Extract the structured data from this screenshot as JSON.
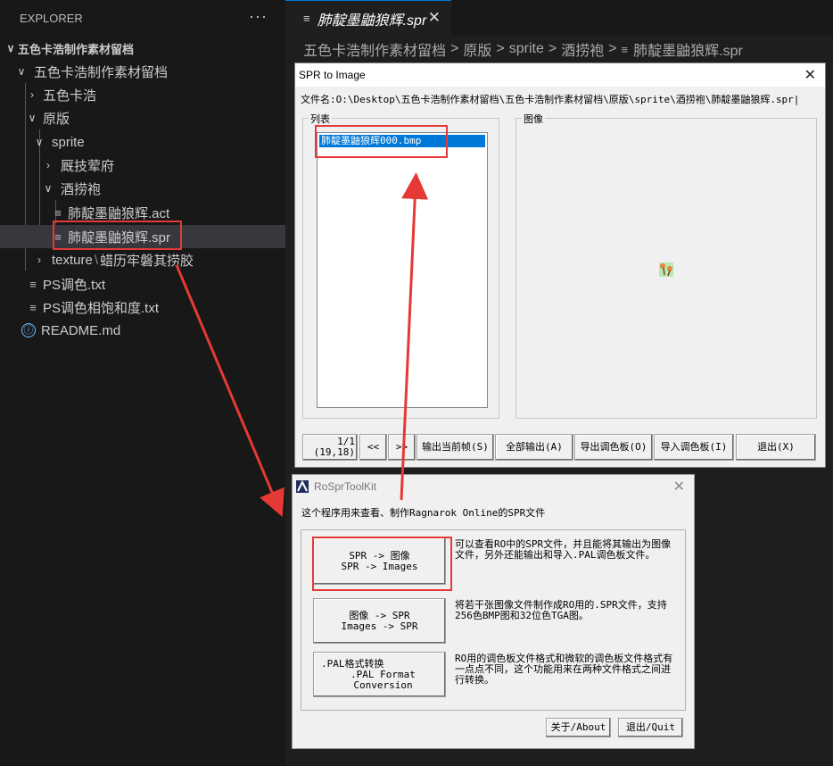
{
  "explorer": {
    "title": "EXPLORER",
    "more_icon": "···",
    "items": [
      {
        "label": "五色卡浩制作素材留档",
        "twisty": "∨"
      },
      {
        "label": "五色卡浩制作素材留档",
        "twisty": "∨"
      },
      {
        "label": "五色卡浩",
        "twisty": "›"
      },
      {
        "label": "原版",
        "twisty": "∨"
      },
      {
        "label": "sprite",
        "twisty": "∨"
      },
      {
        "label": "厩技荤府",
        "twisty": "›"
      },
      {
        "label": "酒捞袍",
        "twisty": "∨"
      },
      {
        "label": "肺靛墨鼬狼辉.act",
        "icon": "≡"
      },
      {
        "label": "肺靛墨鼬狼辉.spr",
        "icon": "≡"
      },
      {
        "label_a": "texture",
        "label_sep": "\\",
        "label_b": "蜡历牢磐其捞胶",
        "twisty": "›"
      },
      {
        "label": "PS调色.txt",
        "icon": "≡"
      },
      {
        "label": "PS调色相饱和度.txt",
        "icon": "≡"
      },
      {
        "label": "README.md",
        "icon": "ⓘ"
      }
    ]
  },
  "editor": {
    "tab": {
      "icon": "≡",
      "label": "肺靛墨鼬狼辉.spr",
      "close": "✕"
    },
    "breadcrumb": [
      "五色卡浩制作素材留档",
      "原版",
      "sprite",
      "酒捞袍",
      "肺靛墨鼬狼辉.spr"
    ],
    "breadcrumb_sep": ">",
    "breadcrumb_file_icon": "≡"
  },
  "spr_dialog": {
    "title": "SPR to Image",
    "close": "✕",
    "filename": "文件名:O:\\Desktop\\五色卡浩制作素材留档\\五色卡浩制作素材留档\\原版\\sprite\\酒捞袍\\肺靛墨鼬狼辉.spr|",
    "list_label": "列表",
    "list_items": [
      "肺靛墨鼬狼辉000.bmp"
    ],
    "image_label": "图像",
    "frame_counter": "1/1",
    "frame_size": "(19,18)",
    "buttons": [
      "<<",
      ">>",
      "输出当前帧(S)",
      "全部输出(A)",
      "导出调色板(O)",
      "导入调色板(I)",
      "退出(X)"
    ]
  },
  "toolkit": {
    "title": "RoSprToolKit",
    "close": "✕",
    "intro": "这个程序用来查看、制作Ragnarok Online的SPR文件",
    "rows": [
      {
        "btn_line1": "SPR -> 图像",
        "btn_line2": "SPR -> Images",
        "desc": "可以查看RO中的SPR文件，并且能将其输出为图像文件，另外还能输出和导入.PAL调色板文件。"
      },
      {
        "btn_line1": "图像 -> SPR",
        "btn_line2": "Images -> SPR",
        "desc": "将若干张图像文件制作成RO用的.SPR文件，支持256色BMP图和32位色TGA图。"
      },
      {
        "btn_line1": ".PAL格式转换",
        "btn_line2": ".PAL Format Conversion",
        "desc": "RO用的调色板文件格式和微软的调色板文件格式有一点点不同，这个功能用来在两种文件格式之间进行转换。"
      }
    ],
    "about": "关于/About",
    "quit": "退出/Quit"
  },
  "colors": {
    "annotation": "#e53935",
    "list_selection": "#0078d7",
    "vscode_accent": "#0078d4"
  }
}
